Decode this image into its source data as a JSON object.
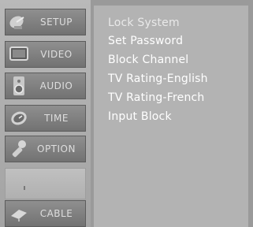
{
  "sidebar": {
    "items": [
      {
        "label": "SETUP",
        "icon": "satellite-dish-icon"
      },
      {
        "label": "VIDEO",
        "icon": "monitor-icon"
      },
      {
        "label": "AUDIO",
        "icon": "speaker-icon"
      },
      {
        "label": "TIME",
        "icon": "clock-icon"
      },
      {
        "label": "OPTION",
        "icon": "wrench-icon"
      },
      {
        "label": "",
        "icon": "lock-icon"
      },
      {
        "label": "CABLE",
        "icon": "cable-icon"
      }
    ]
  },
  "panel": {
    "items": [
      "Lock System",
      "Set Password",
      "Block Channel",
      "TV Rating-English",
      "TV Rating-French",
      "Input Block"
    ]
  }
}
